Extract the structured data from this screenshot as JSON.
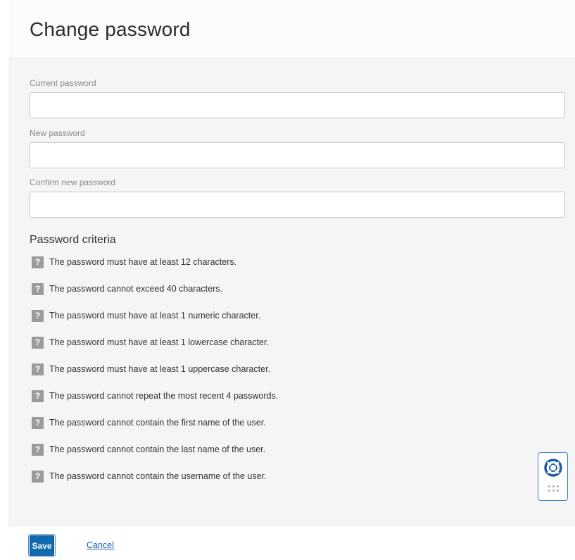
{
  "page": {
    "title": "Change password"
  },
  "form": {
    "current_password": {
      "label": "Current password",
      "value": "",
      "placeholder": ""
    },
    "new_password": {
      "label": "New password",
      "value": "",
      "placeholder": ""
    },
    "confirm_password": {
      "label": "Confirm new password",
      "value": "",
      "placeholder": ""
    }
  },
  "criteria": {
    "heading": "Password criteria",
    "status_icon": "question-mark-icon",
    "items": [
      "The password must have at least 12 characters.",
      "The password cannot exceed 40 characters.",
      "The password must have at least 1 numeric character.",
      "The password must have at least 1 lowercase character.",
      "The password must have at least 1 uppercase character.",
      "The password cannot repeat the most recent 4 passwords.",
      "The password cannot contain the first name of the user.",
      "The password cannot contain the last name of the user.",
      "The password cannot contain the username of the user."
    ]
  },
  "help_widget": {
    "icon": "lifebuoy-icon",
    "handle_icon": "drag-handle-icon"
  },
  "footer": {
    "save_label": "Save",
    "cancel_label": "Cancel"
  },
  "colors": {
    "primary": "#0f6ab0",
    "link": "#1a5fb4",
    "status_icon_bg": "#9b9b9b",
    "panel_bg": "#f5f5f5"
  }
}
